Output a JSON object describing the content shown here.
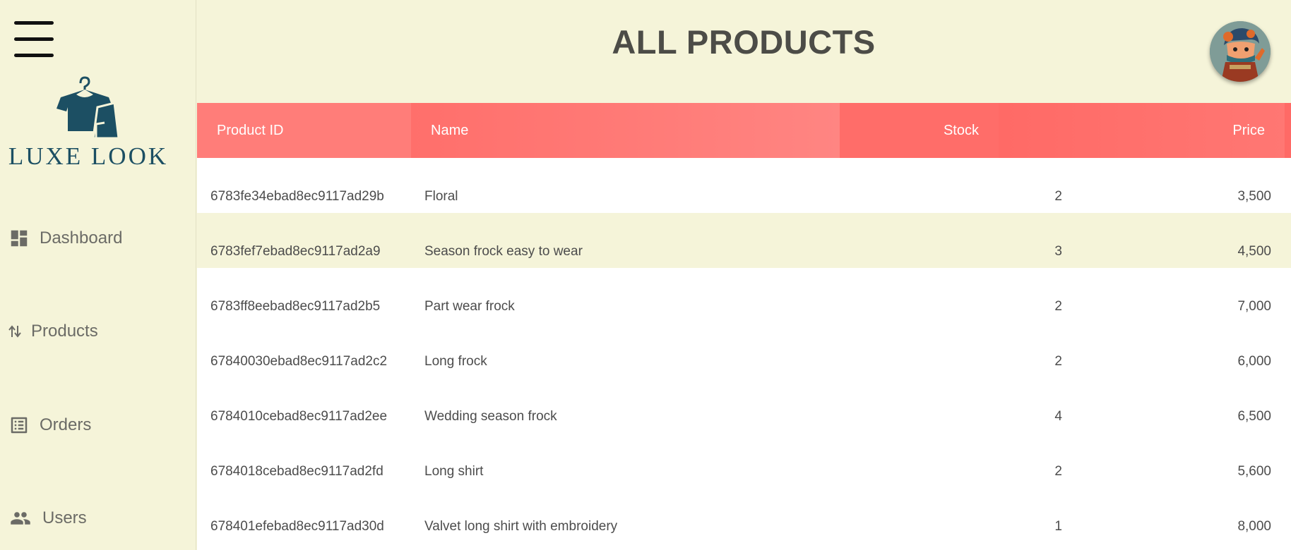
{
  "brand": {
    "name": "LUXE LOOK"
  },
  "page": {
    "title": "ALL PRODUCTS"
  },
  "sidebar": {
    "items": [
      {
        "label": "Dashboard",
        "icon": "dashboard-icon"
      },
      {
        "label": "Products",
        "icon": "sort-arrows-icon"
      },
      {
        "label": "Orders",
        "icon": "list-icon"
      },
      {
        "label": "Users",
        "icon": "users-icon"
      }
    ]
  },
  "table": {
    "headers": [
      "Product ID",
      "Name",
      "Stock",
      "Price"
    ],
    "rows": [
      {
        "id": "6783fe34ebad8ec9117ad29b",
        "name": "Floral",
        "stock": "2",
        "price": "3,500"
      },
      {
        "id": "6783fef7ebad8ec9117ad2a9",
        "name": "Season frock easy to wear",
        "stock": "3",
        "price": "4,500"
      },
      {
        "id": "6783ff8eebad8ec9117ad2b5",
        "name": "Part wear frock",
        "stock": "2",
        "price": "7,000"
      },
      {
        "id": "67840030ebad8ec9117ad2c2",
        "name": "Long frock",
        "stock": "2",
        "price": "6,000"
      },
      {
        "id": "6784010cebad8ec9117ad2ee",
        "name": "Wedding season frock",
        "stock": "4",
        "price": "6,500"
      },
      {
        "id": "6784018cebad8ec9117ad2fd",
        "name": "Long shirt",
        "stock": "2",
        "price": "5,600"
      },
      {
        "id": "678401efebad8ec9117ad30d",
        "name": "Valvet long shirt with embroidery",
        "stock": "1",
        "price": "8,000"
      }
    ]
  },
  "colors": {
    "background": "#f5f4d9",
    "header_accent": "#ff6f6b",
    "brand": "#1c4f63"
  }
}
